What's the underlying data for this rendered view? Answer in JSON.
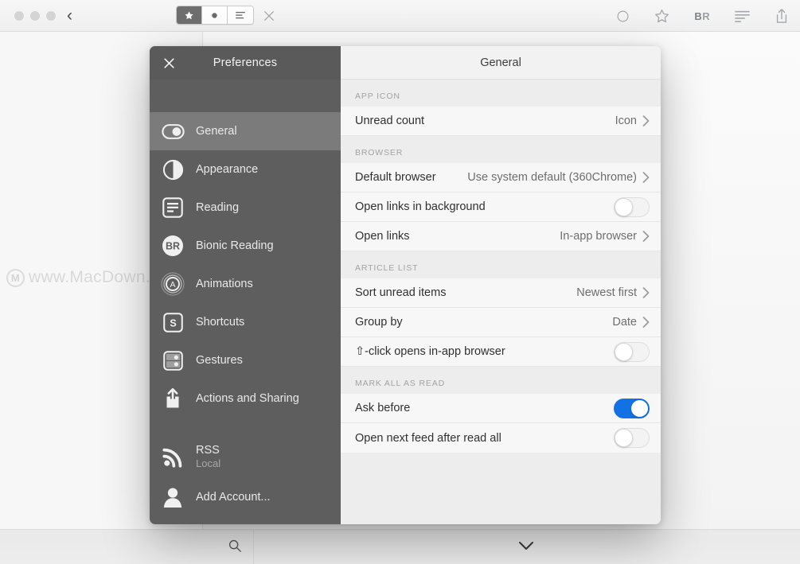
{
  "background_window": {
    "toolbar": {
      "back_label": "‹",
      "segmented": [
        {
          "name": "star-view",
          "glyph": "★",
          "active": true
        },
        {
          "name": "dot-view",
          "glyph": "●",
          "active": false
        },
        {
          "name": "list-view",
          "glyph": "≡",
          "active": false
        }
      ],
      "close_label": "✕",
      "right_icons": [
        {
          "name": "circle-icon",
          "glyph": "○"
        },
        {
          "name": "star-outline-icon",
          "glyph": "☆"
        },
        {
          "name": "bionic-reading-icon",
          "label": "BR"
        },
        {
          "name": "text-lines-icon",
          "glyph": "≡"
        },
        {
          "name": "share-icon",
          "glyph": "⇪"
        }
      ]
    },
    "bottom_bar": {
      "search_glyph": "⌕",
      "chevron_glyph": "⌄"
    }
  },
  "watermark": {
    "logo_letter": "M",
    "text": "www.MacDown.com"
  },
  "preferences": {
    "sidebar": {
      "close_label": "✕",
      "title": "Preferences",
      "items": [
        {
          "label": "General",
          "icon": "toggle-switch-icon",
          "active": true
        },
        {
          "label": "Appearance",
          "icon": "half-circle-icon",
          "active": false
        },
        {
          "label": "Reading",
          "icon": "document-lines-icon",
          "active": false
        },
        {
          "label": "Bionic Reading",
          "icon": "br-circle-icon",
          "active": false
        },
        {
          "label": "Animations",
          "icon": "animation-a-icon",
          "active": false
        },
        {
          "label": "Shortcuts",
          "icon": "key-s-icon",
          "active": false
        },
        {
          "label": "Gestures",
          "icon": "gesture-dots-icon",
          "active": false
        },
        {
          "label": "Actions and Sharing",
          "icon": "share-up-icon",
          "active": false
        }
      ],
      "accounts": [
        {
          "label": "RSS",
          "sublabel": "Local",
          "icon": "rss-icon"
        },
        {
          "label": "Add Account...",
          "sublabel": "",
          "icon": "person-icon"
        }
      ]
    },
    "content": {
      "title": "General",
      "sections": [
        {
          "header": "APP ICON",
          "rows": [
            {
              "label": "Unread count",
              "type": "disclosure",
              "value": "Icon"
            }
          ]
        },
        {
          "header": "BROWSER",
          "rows": [
            {
              "label": "Default browser",
              "type": "disclosure",
              "value": "Use system default (360Chrome)"
            },
            {
              "label": "Open links in background",
              "type": "toggle",
              "on": false
            },
            {
              "label": "Open links",
              "type": "disclosure",
              "value": "In-app browser"
            }
          ]
        },
        {
          "header": "ARTICLE LIST",
          "rows": [
            {
              "label": "Sort unread items",
              "type": "disclosure",
              "value": "Newest first"
            },
            {
              "label": "Group by",
              "type": "disclosure",
              "value": "Date"
            },
            {
              "label": "⇧-click opens in-app browser",
              "type": "toggle",
              "on": false
            }
          ]
        },
        {
          "header": "MARK ALL AS READ",
          "rows": [
            {
              "label": "Ask before",
              "type": "toggle",
              "on": true
            },
            {
              "label": "Open next feed after read all",
              "type": "toggle",
              "on": false
            }
          ]
        }
      ]
    }
  },
  "colors": {
    "sidebar_bg": "#5e5e5e",
    "sidebar_active": "#7b7b7b",
    "content_bg": "#ededed",
    "row_bg": "#f7f7f7",
    "toggle_on": "#1272e4"
  }
}
